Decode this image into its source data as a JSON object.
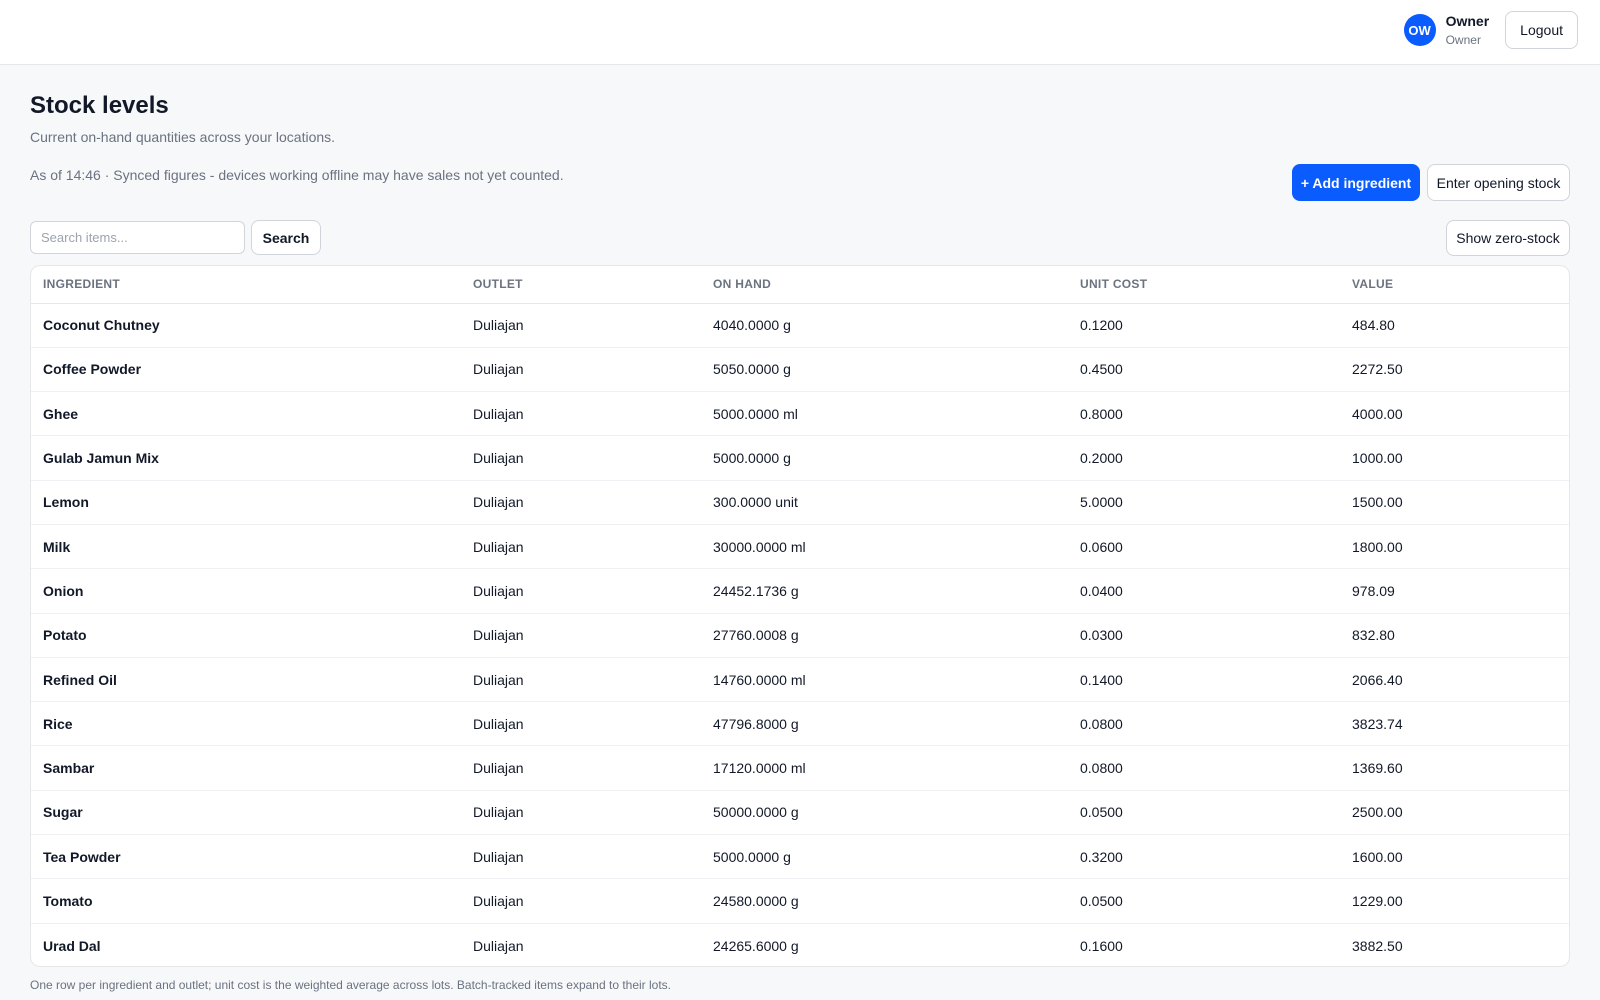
{
  "user": {
    "initials": "OW",
    "name": "Owner",
    "role": "Owner",
    "logout_label": "Logout"
  },
  "page": {
    "title": "Stock levels",
    "subtitle": "Current on-hand quantities across your locations.",
    "sync_note": "As of 14:46 · Synced figures - devices working offline may have sales not yet counted."
  },
  "actions": {
    "add_ingredient": "+ Add ingredient",
    "enter_opening_stock": "Enter opening stock",
    "show_zero_stock": "Show zero-stock"
  },
  "search": {
    "placeholder": "Search items...",
    "value": "",
    "button_label": "Search"
  },
  "table": {
    "columns": [
      "INGREDIENT",
      "OUTLET",
      "ON HAND",
      "UNIT COST",
      "VALUE"
    ],
    "rows": [
      {
        "ingredient": "Coconut Chutney",
        "outlet": "Duliajan",
        "on_hand": "4040.0000 g",
        "unit_cost": "0.1200",
        "value": "484.80"
      },
      {
        "ingredient": "Coffee Powder",
        "outlet": "Duliajan",
        "on_hand": "5050.0000 g",
        "unit_cost": "0.4500",
        "value": "2272.50"
      },
      {
        "ingredient": "Ghee",
        "outlet": "Duliajan",
        "on_hand": "5000.0000 ml",
        "unit_cost": "0.8000",
        "value": "4000.00"
      },
      {
        "ingredient": "Gulab Jamun Mix",
        "outlet": "Duliajan",
        "on_hand": "5000.0000 g",
        "unit_cost": "0.2000",
        "value": "1000.00"
      },
      {
        "ingredient": "Lemon",
        "outlet": "Duliajan",
        "on_hand": "300.0000 unit",
        "unit_cost": "5.0000",
        "value": "1500.00"
      },
      {
        "ingredient": "Milk",
        "outlet": "Duliajan",
        "on_hand": "30000.0000 ml",
        "unit_cost": "0.0600",
        "value": "1800.00"
      },
      {
        "ingredient": "Onion",
        "outlet": "Duliajan",
        "on_hand": "24452.1736 g",
        "unit_cost": "0.0400",
        "value": "978.09"
      },
      {
        "ingredient": "Potato",
        "outlet": "Duliajan",
        "on_hand": "27760.0008 g",
        "unit_cost": "0.0300",
        "value": "832.80"
      },
      {
        "ingredient": "Refined Oil",
        "outlet": "Duliajan",
        "on_hand": "14760.0000 ml",
        "unit_cost": "0.1400",
        "value": "2066.40"
      },
      {
        "ingredient": "Rice",
        "outlet": "Duliajan",
        "on_hand": "47796.8000 g",
        "unit_cost": "0.0800",
        "value": "3823.74"
      },
      {
        "ingredient": "Sambar",
        "outlet": "Duliajan",
        "on_hand": "17120.0000 ml",
        "unit_cost": "0.0800",
        "value": "1369.60"
      },
      {
        "ingredient": "Sugar",
        "outlet": "Duliajan",
        "on_hand": "50000.0000 g",
        "unit_cost": "0.0500",
        "value": "2500.00"
      },
      {
        "ingredient": "Tea Powder",
        "outlet": "Duliajan",
        "on_hand": "5000.0000 g",
        "unit_cost": "0.3200",
        "value": "1600.00"
      },
      {
        "ingredient": "Tomato",
        "outlet": "Duliajan",
        "on_hand": "24580.0000 g",
        "unit_cost": "0.0500",
        "value": "1229.00"
      },
      {
        "ingredient": "Urad Dal",
        "outlet": "Duliajan",
        "on_hand": "24265.6000 g",
        "unit_cost": "0.1600",
        "value": "3882.50"
      }
    ]
  },
  "footnote": "One row per ingredient and outlet; unit cost is the weighted average across lots. Batch-tracked items expand to their lots.",
  "colors": {
    "accent": "#0a5cff",
    "background": "#f6f8fa",
    "muted_text": "#6b7280"
  }
}
